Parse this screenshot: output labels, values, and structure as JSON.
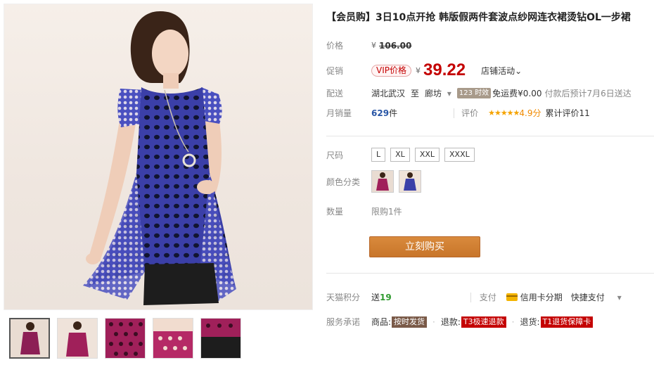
{
  "product": {
    "title": "【会员购】3日10点开抢 韩版假两件套波点纱网连衣裙烫钻OL一步裙"
  },
  "price": {
    "label": "价格",
    "currency": "¥",
    "original": "106.00"
  },
  "promo": {
    "label": "促销",
    "vip_tag": "VIP价格",
    "currency": "¥",
    "price": "39.22",
    "activity": "店铺活动",
    "activity_caret": "⌄"
  },
  "shipping": {
    "label": "配送",
    "from": "湖北武汉",
    "to_word": "至",
    "to": "廊坊",
    "caret": "▾",
    "badge": "123 时效",
    "fee": "免运费¥0.00",
    "eta": "付款后预计7月6日送达"
  },
  "sales": {
    "label": "月销量",
    "count": "629",
    "unit": "件",
    "rating_label": "评价",
    "stars": "★★★★★",
    "score": "4.9分",
    "review_count": "累计评价11"
  },
  "size": {
    "label": "尺码",
    "options": [
      "L",
      "XL",
      "XXL",
      "XXXL"
    ]
  },
  "color": {
    "label": "颜色分类",
    "swatches": [
      "magenta",
      "blue"
    ]
  },
  "quantity": {
    "label": "数量",
    "limit": "限购1件"
  },
  "buy": {
    "label": "立刻购买"
  },
  "points": {
    "label": "天猫积分",
    "prefix": "送",
    "value": "19",
    "pay_label": "支付",
    "card_pay": "信用卡分期",
    "quick_pay": "快捷支付",
    "caret": "▾"
  },
  "service": {
    "label": "服务承诺",
    "goods_prefix": "商品:",
    "goods_tag": "按时发货",
    "refund_prefix": "退款:",
    "refund_tag": "T3极速退款",
    "return_prefix": "退货:",
    "return_tag": "T1退货保障卡"
  },
  "colors": {
    "price_red": "#c40000",
    "buy_orange": "#d08030",
    "dress_blue": "#3b3fa8",
    "dress_magenta": "#a0205a"
  }
}
